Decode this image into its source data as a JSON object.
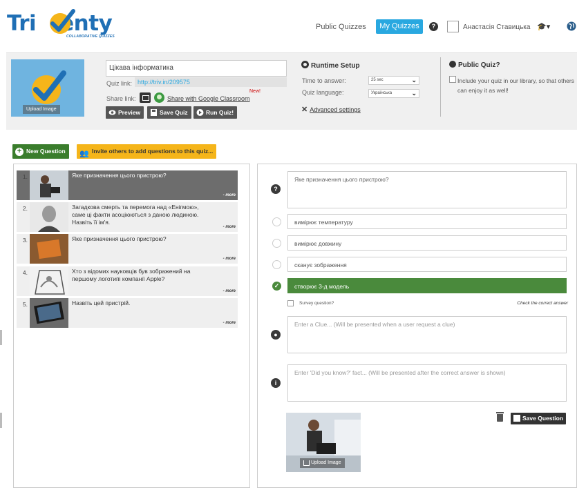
{
  "header": {
    "logo_text_left": "Tri",
    "logo_text_right": "enty",
    "logo_tagline": "COLLABORATIVE QUIZZES",
    "nav_public": "Public Quizzes",
    "nav_my": "My Quizzes",
    "help": "?",
    "user_name": "Анастасія Ставицька",
    "caret": "▾"
  },
  "quiz": {
    "upload_label": "Upload Image",
    "title": "Цікава інформатика",
    "link_label": "Quiz link:",
    "link": "http://triv.in/209575",
    "share_label": "Share link:",
    "share_classroom": "Share with Google Classroom",
    "new_badge": "New!",
    "preview": "Preview",
    "save": "Save Quiz",
    "run": "Run Quiz!"
  },
  "runtime": {
    "title": "Runtime Setup",
    "time_label": "Time to answer:",
    "time_value": "25 sec",
    "lang_label": "Quiz language:",
    "lang_value": "Українська",
    "advanced": "Advanced settings"
  },
  "public_quiz": {
    "title": "Public Quiz?",
    "text": "Include your quiz in our library, so that others can enjoy it as well!"
  },
  "toolbar": {
    "new_question": "New Question",
    "invite": "Invite others to add questions to this quiz..."
  },
  "questions": [
    {
      "num": "1.",
      "text": "Яке призначення цього пристрою?",
      "more": "- more"
    },
    {
      "num": "2.",
      "text": "Загадкова смерть та перемога над «Енігмою», саме ці факти асоціюються з даною людиною. Назвіть її ім'я.",
      "more": "- more"
    },
    {
      "num": "3.",
      "text": "Яке призначення цього пристрою?",
      "more": "- more"
    },
    {
      "num": "4.",
      "text": "Хто з відомих науковців був зображений на першому логотипі компанії Apple?",
      "more": "- more"
    },
    {
      "num": "5.",
      "text": "Назвіть цей пристрій.",
      "more": "- more"
    }
  ],
  "editor": {
    "question": "Яке призначення цього пристрою?",
    "answers": [
      "вимірює температуру",
      "вимірює довжину",
      "сканує зображення",
      "створює 3-д модель"
    ],
    "correct_index": 3,
    "survey": "Survey question?",
    "check_correct": "Check the correct answer",
    "clue_placeholder": "Enter a Clue... (Will be presented when a user request a clue)",
    "dyk_placeholder": "Enter 'Did you know?' fact... (Will be presented after the correct answer is shown)",
    "save_question": "Save Question",
    "upload_label": "Upload Image"
  },
  "colors": {
    "brand_blue": "#1f6fb5",
    "nav_active": "#29a8e0",
    "green": "#3a7d2c",
    "correct_green": "#4a8a3c",
    "invite_yellow": "#f5b51a"
  }
}
